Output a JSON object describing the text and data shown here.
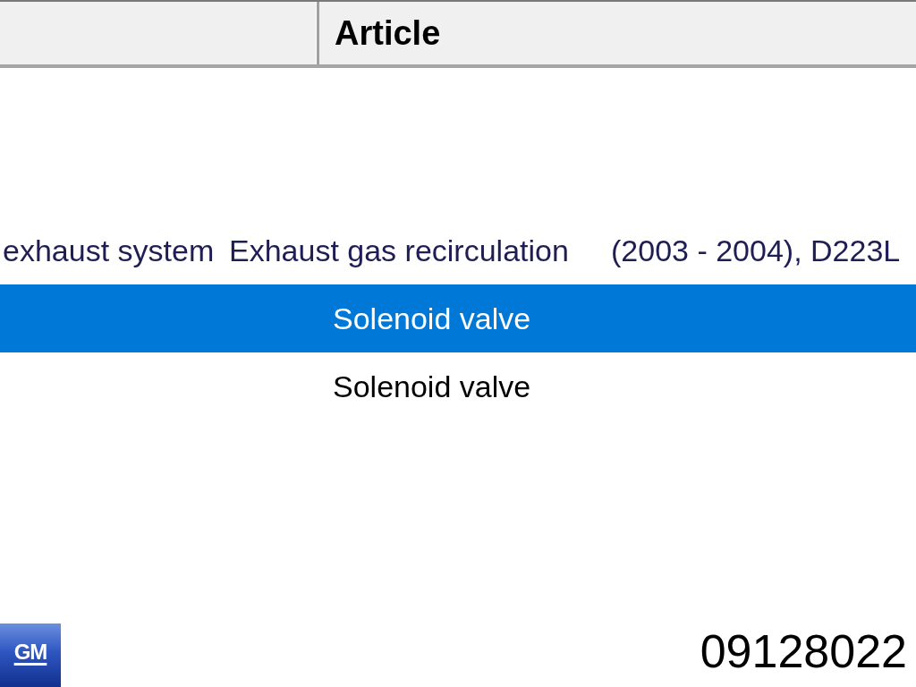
{
  "table": {
    "columns": [
      {
        "kind": "blank"
      },
      {
        "kind": "text",
        "label": "Article"
      }
    ],
    "rows": [
      {
        "kind": "group",
        "selected": false,
        "cells": [
          "exhaust system",
          "Exhaust gas recirculation",
          "(2003 - 2004), D223L"
        ]
      },
      {
        "kind": "item",
        "selected": true,
        "article": "Solenoid valve"
      },
      {
        "kind": "item",
        "selected": false,
        "article": "Solenoid valve"
      }
    ]
  },
  "footer": {
    "logo": "GM",
    "part_number": "09128022"
  }
}
